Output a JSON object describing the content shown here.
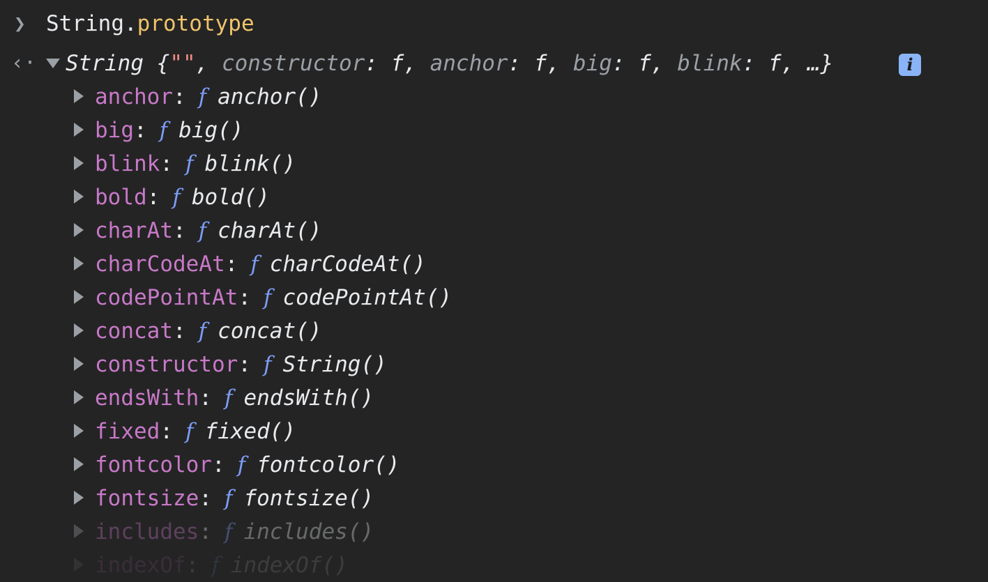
{
  "console": {
    "input": {
      "object": "String",
      "dot": ".",
      "property": "prototype"
    },
    "result": {
      "type": "String",
      "open_brace": " {",
      "string_literal": "\"\"",
      "preview_rest_1": ", ",
      "k1": "constructor",
      "v1": ": f, ",
      "k2": "anchor",
      "v2": ": f, ",
      "k3": "big",
      "v3": ": f, ",
      "k4": "blink",
      "v4": ": f, …}",
      "info_badge": "i"
    },
    "properties": [
      {
        "key": "anchor",
        "glyph": "f",
        "name": "anchor()"
      },
      {
        "key": "big",
        "glyph": "f",
        "name": "big()"
      },
      {
        "key": "blink",
        "glyph": "f",
        "name": "blink()"
      },
      {
        "key": "bold",
        "glyph": "f",
        "name": "bold()"
      },
      {
        "key": "charAt",
        "glyph": "f",
        "name": "charAt()"
      },
      {
        "key": "charCodeAt",
        "glyph": "f",
        "name": "charCodeAt()"
      },
      {
        "key": "codePointAt",
        "glyph": "f",
        "name": "codePointAt()"
      },
      {
        "key": "concat",
        "glyph": "f",
        "name": "concat()"
      },
      {
        "key": "constructor",
        "glyph": "f",
        "name": "String()"
      },
      {
        "key": "endsWith",
        "glyph": "f",
        "name": "endsWith()"
      },
      {
        "key": "fixed",
        "glyph": "f",
        "name": "fixed()"
      },
      {
        "key": "fontcolor",
        "glyph": "f",
        "name": "fontcolor()"
      },
      {
        "key": "fontsize",
        "glyph": "f",
        "name": "fontsize()"
      },
      {
        "key": "includes",
        "glyph": "f",
        "name": "includes()"
      },
      {
        "key": "indexOf",
        "glyph": "f",
        "name": "indexOf()"
      }
    ],
    "colors": {
      "background": "#242424",
      "property_key": "#c879c8",
      "function_glyph": "#7d9cf7",
      "accessor": "#f0c46c",
      "string_literal": "#f28b82"
    }
  }
}
